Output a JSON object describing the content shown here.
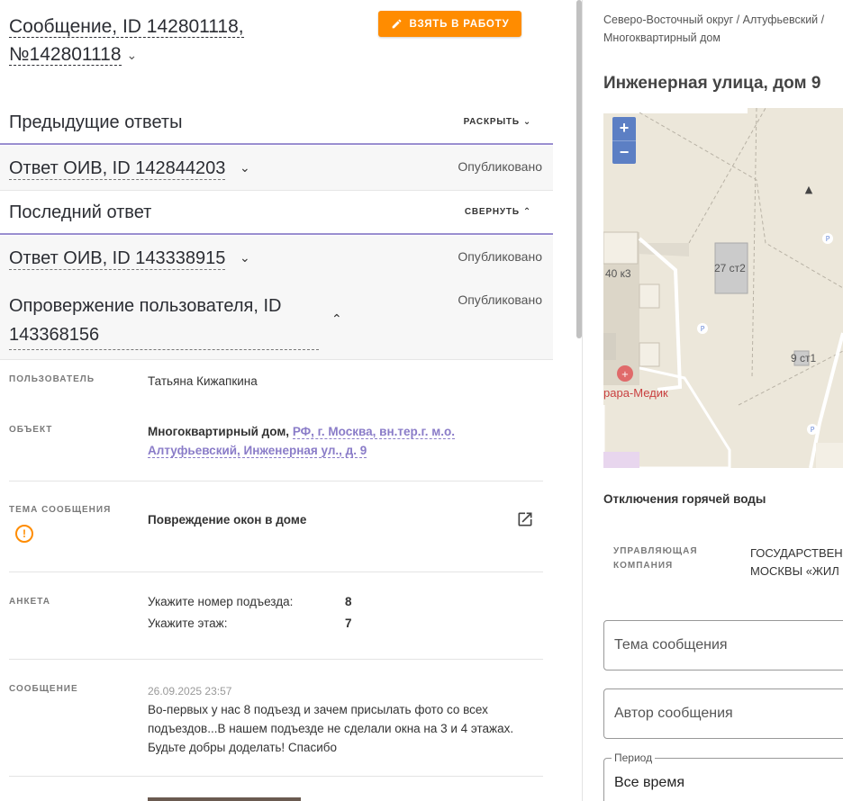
{
  "header": {
    "title_line1": "Сообщение, ID 142801118,",
    "title_line2": "№142801118",
    "take_button": "ВЗЯТЬ В РАБОТУ"
  },
  "previous": {
    "heading": "Предыдущие ответы",
    "action": "РАСКРЫТЬ",
    "items": [
      {
        "title": "Ответ ОИВ, ID 142844203",
        "status": "Опубликовано"
      }
    ]
  },
  "last": {
    "heading": "Последний ответ",
    "action": "СВЕРНУТЬ",
    "reply": {
      "title": "Ответ ОИВ, ID 143338915",
      "status": "Опубликовано"
    },
    "dispute": {
      "title": "Опровержение пользователя, ID 143368156",
      "status": "Опубликовано"
    }
  },
  "details": {
    "user_label": "ПОЛЬЗОВАТЕЛЬ",
    "user_value": "Татьяна Кижапкина",
    "object_label": "ОБЪЕКТ",
    "object_prefix": "Многоквартирный дом, ",
    "object_link_1": "РФ, г. Москва, вн.тер.г. м.о.",
    "object_link_2": "Алтуфьевский, Инженерная ул., д. 9",
    "topic_label": "ТЕМА СООБЩЕНИЯ",
    "topic_value": "Повреждение окон в доме",
    "survey_label": "АНКЕТА",
    "survey": [
      {
        "q": "Укажите номер подъезда:",
        "a": "8"
      },
      {
        "q": "Укажите этаж:",
        "a": "7"
      }
    ],
    "message_label": "СООБЩЕНИЕ",
    "message_date": "26.09.2025 23:57",
    "message_lines": [
      "Во-первых у нас 8 подъезд и зачем присылать фото со всех",
      "подъездов...В нашем подъезде не сделали окна на 3 и 4 этажах.",
      "Будьте добры доделать! Спасибо"
    ]
  },
  "right": {
    "crumbs_line1": "Северо-Восточный округ / Алтуфьевский /",
    "crumbs_line2": "Многоквартирный дом",
    "address": "Инженерная улица, дом 9",
    "map": {
      "zoom_in": "+",
      "zoom_out": "−",
      "labels": [
        "40 к3",
        "27 ст2",
        "9 ст1",
        "рара-Медик"
      ]
    },
    "hot_water": "Отключения горячей воды",
    "mc_label_1": "УПРАВЛЯЮЩАЯ",
    "mc_label_2": "КОМПАНИЯ",
    "mc_value_1": "ГОСУДАРСТВЕН",
    "mc_value_2": "МОСКВЫ «ЖИЛ",
    "filters": {
      "topic_placeholder": "Тема сообщения",
      "author_placeholder": "Автор сообщения",
      "period_label": "Период",
      "period_value": "Все время"
    }
  }
}
